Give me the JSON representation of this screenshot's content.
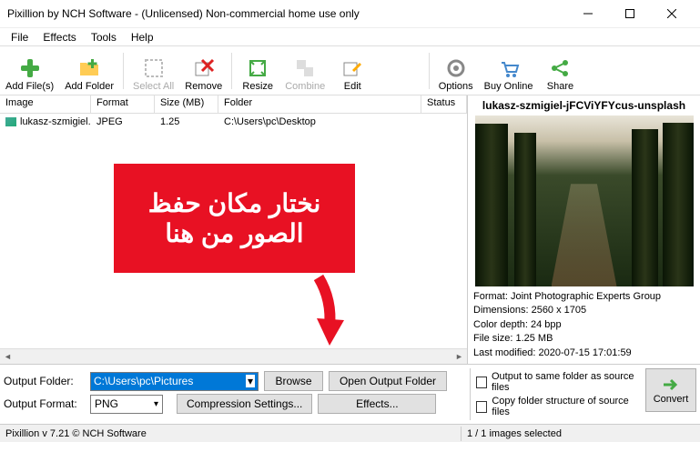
{
  "window": {
    "title": "Pixillion by NCH Software - (Unlicensed) Non-commercial home use only"
  },
  "menu": {
    "file": "File",
    "effects": "Effects",
    "tools": "Tools",
    "help": "Help"
  },
  "toolbar": {
    "addfiles": "Add File(s)",
    "addfolder": "Add Folder",
    "selectall": "Select All",
    "remove": "Remove",
    "resize": "Resize",
    "combine": "Combine",
    "edit": "Edit",
    "options": "Options",
    "buyonline": "Buy Online",
    "share": "Share"
  },
  "table": {
    "headers": {
      "image": "Image",
      "format": "Format",
      "size": "Size (MB)",
      "folder": "Folder",
      "status": "Status"
    },
    "row": {
      "name": "lukasz-szmigiel...",
      "format": "JPEG",
      "size": "1.25",
      "folder": "C:\\Users\\pc\\Desktop",
      "status": ""
    }
  },
  "callout": {
    "text": "نختار مكان حفظ الصور من هنا"
  },
  "preview": {
    "title": "lukasz-szmigiel-jFCViYFYcus-unsplash",
    "meta": {
      "l1": "Format: Joint Photographic Experts Group",
      "l2": "Dimensions: 2560 x 1705",
      "l3": "Color depth: 24 bpp",
      "l4": "File size: 1.25 MB",
      "l5": "Last modified: 2020-07-15 17:01:59"
    }
  },
  "output": {
    "folder_label": "Output Folder:",
    "folder_value": "C:\\Users\\pc\\Pictures",
    "browse": "Browse",
    "open": "Open Output Folder",
    "format_label": "Output Format:",
    "format_value": "PNG",
    "compression": "Compression Settings...",
    "effects": "Effects...",
    "chk1": "Output to same folder as source files",
    "chk2": "Copy folder structure of source files",
    "convert": "Convert"
  },
  "status": {
    "left": "Pixillion v 7.21   © NCH Software",
    "right": "1 / 1 images selected"
  }
}
